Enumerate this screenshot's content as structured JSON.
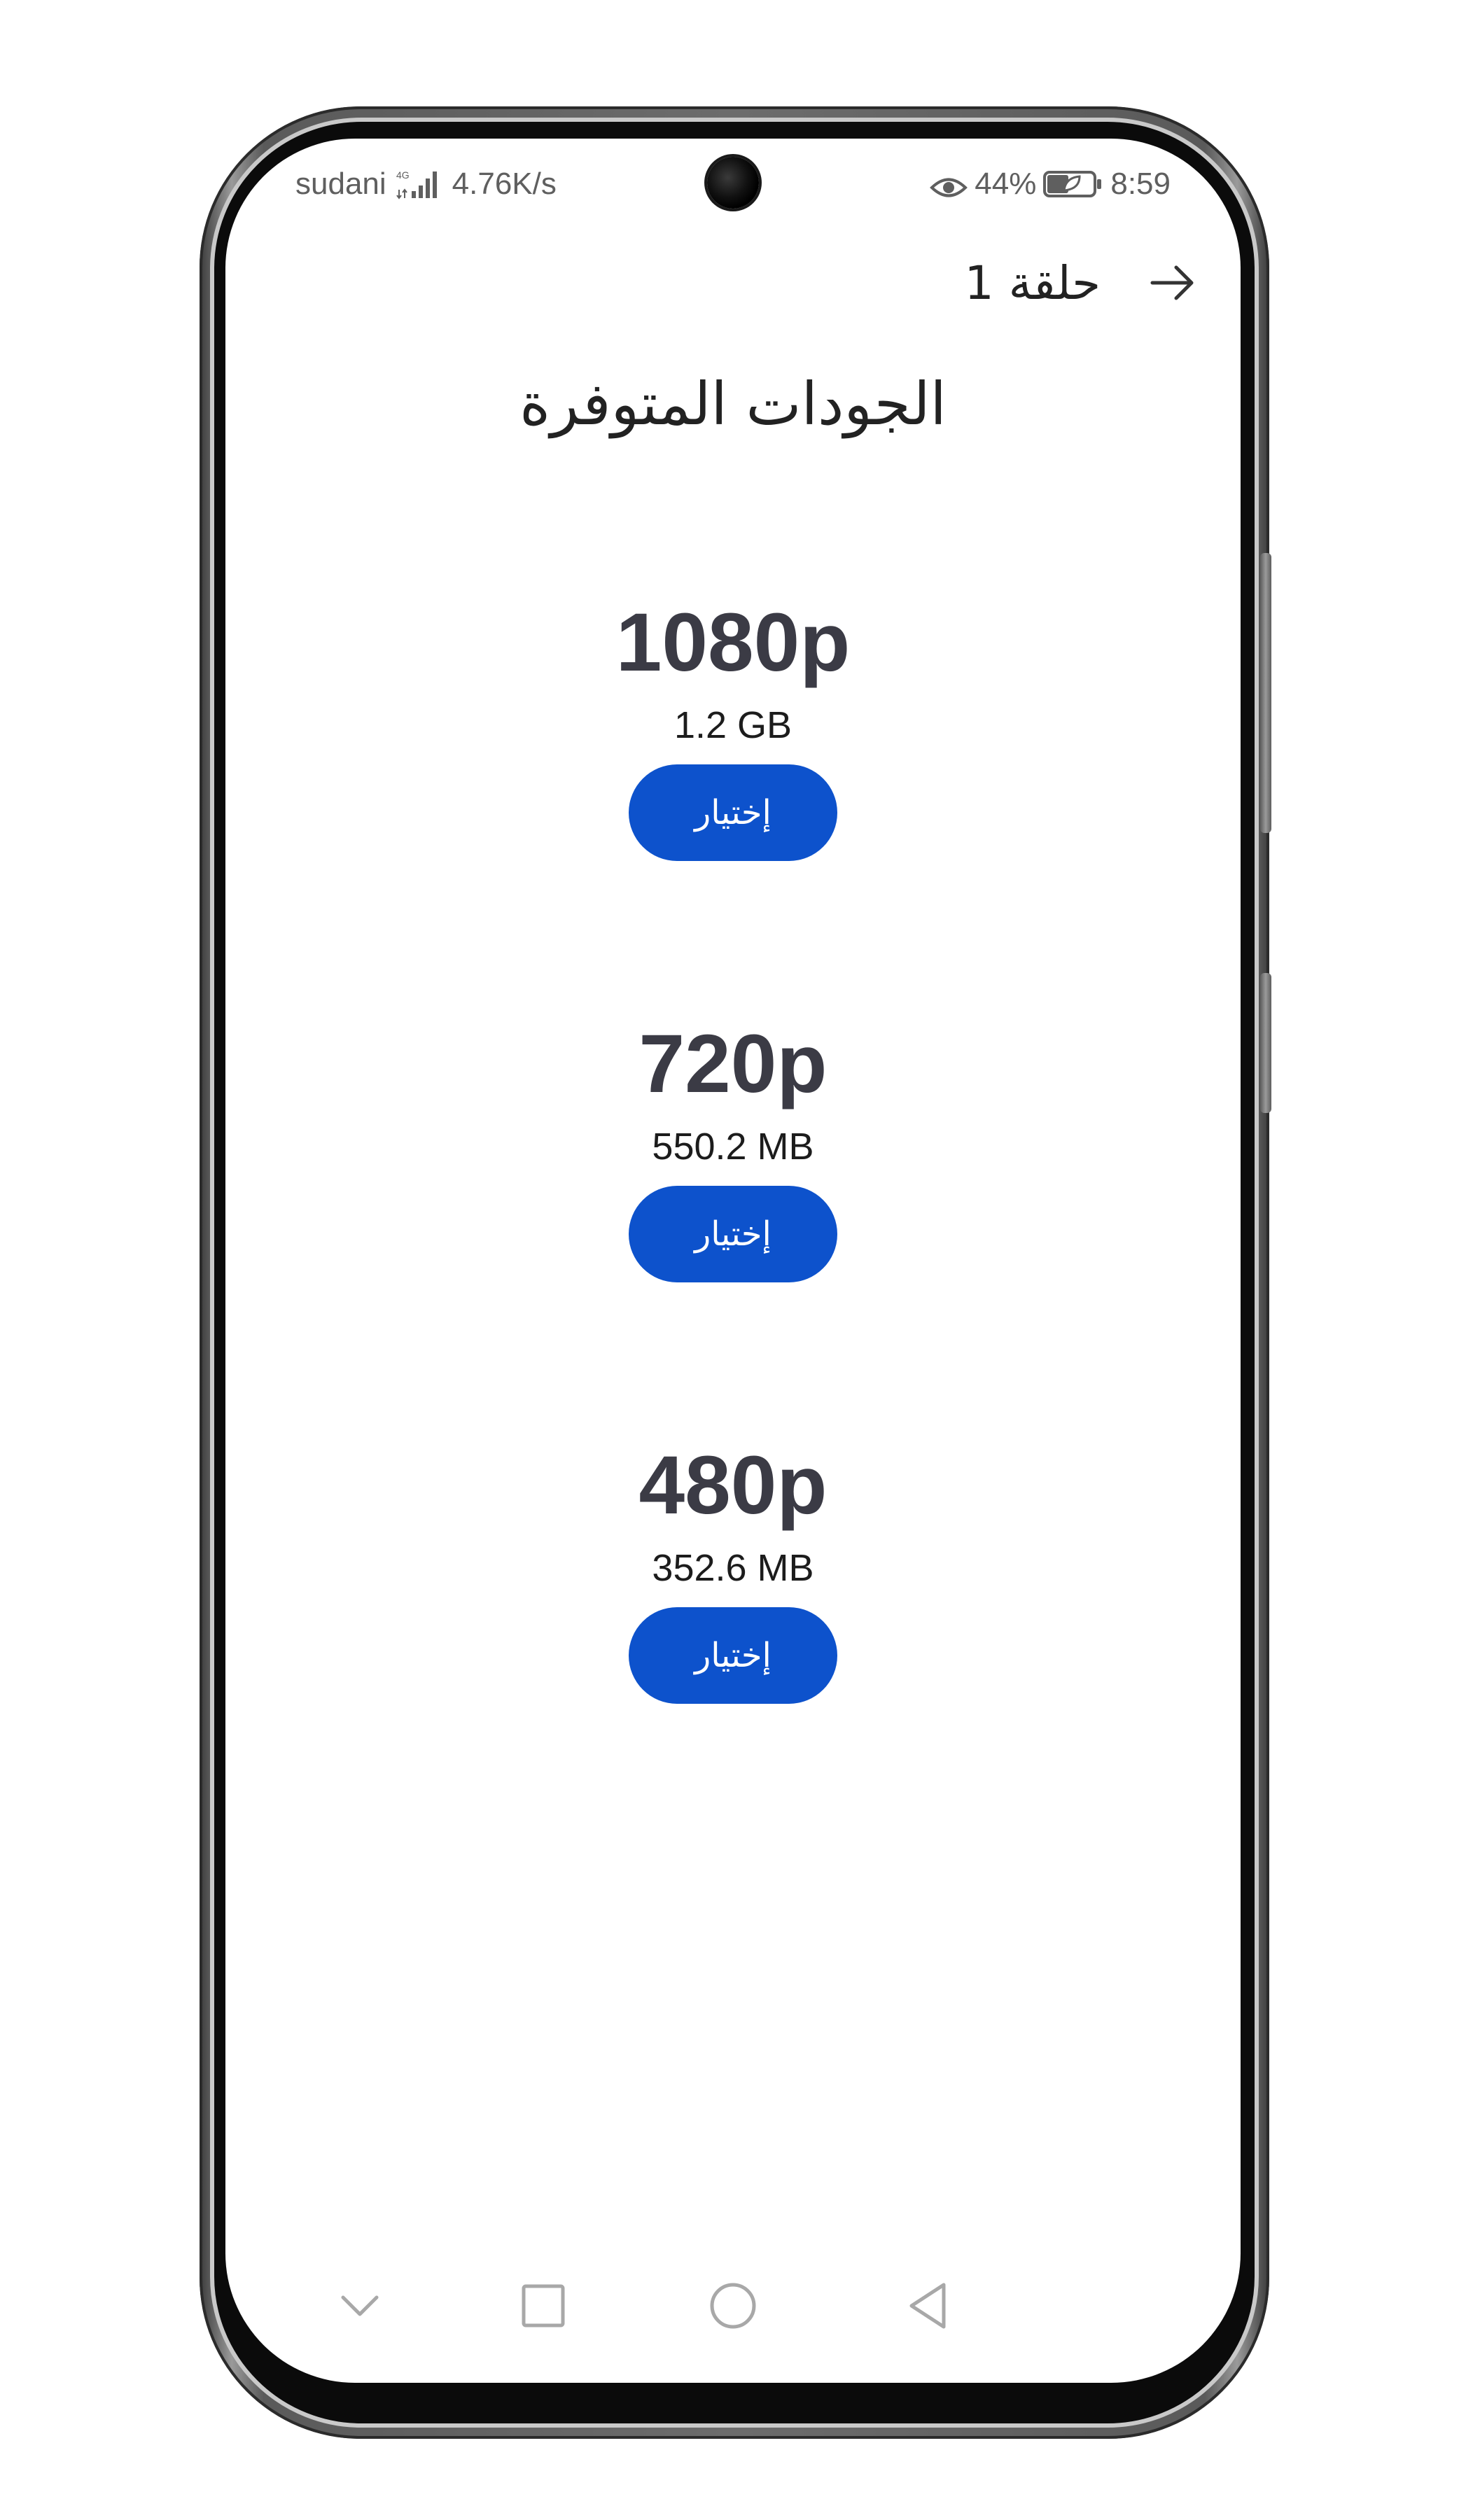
{
  "status_bar": {
    "carrier": "sudani",
    "network_type": "4G",
    "speed": "4.76K/s",
    "battery": "44%",
    "time": "8:59"
  },
  "header": {
    "episode_title": "حلقة 1",
    "back_icon": "arrow-right-icon"
  },
  "page": {
    "title": "الجودات المتوفرة"
  },
  "qualities": [
    {
      "label": "1080p",
      "size": "1.2 GB",
      "button_label": "إختيار"
    },
    {
      "label": "720p",
      "size": "550.2 MB",
      "button_label": "إختيار"
    },
    {
      "label": "480p",
      "size": "352.6 MB",
      "button_label": "إختيار"
    }
  ],
  "nav_bar": {
    "icons": [
      "chevron-down-icon",
      "square-icon",
      "circle-icon",
      "triangle-back-icon"
    ]
  },
  "colors": {
    "accent": "#0d52cc",
    "quality_text": "#3b3b45",
    "status_text": "#5f5f5f"
  }
}
